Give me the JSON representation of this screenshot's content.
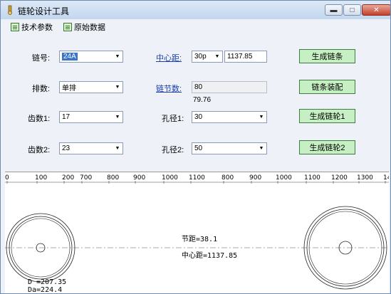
{
  "window": {
    "title": "链轮设计工具",
    "minimize_glyph": "▬",
    "maximize_glyph": "□",
    "close_glyph": "✕"
  },
  "toolbar": {
    "tech_params": "技术参数",
    "raw_data": "原始数据"
  },
  "form": {
    "chain_no_label": "链号:",
    "chain_no_value": "24A",
    "rows_label": "排数:",
    "rows_value": "单排",
    "teeth1_label": "齿数1:",
    "teeth1_value": "17",
    "teeth2_label": "齿数2:",
    "teeth2_value": "23",
    "center_label": "中心距:",
    "center_unit_value": "30p",
    "center_value": "1137.85",
    "links_label": "链节数:",
    "links_value": "80",
    "links_calc": "79.76",
    "bore1_label": "孔径1:",
    "bore1_value": "30",
    "bore2_label": "孔径2:",
    "bore2_value": "50"
  },
  "buttons": {
    "gen_chain": "生成链条",
    "chain_assembly": "链条装配",
    "gen_sprocket1": "生成链轮1",
    "gen_sprocket2": "生成链轮2"
  },
  "ruler": {
    "ticks": [
      "0",
      "100",
      "200",
      "700",
      "800",
      "900",
      "1000",
      "1100",
      "800",
      "900",
      "1000",
      "1100",
      "1200",
      "1300",
      "140"
    ]
  },
  "drawing": {
    "pitch_text": "节距=38.1",
    "center_text": "中心距=1137.85",
    "d_text": "D =207.35",
    "da_text": "Da=224.4"
  },
  "colors": {
    "button_green": "#c6f0c3",
    "link_blue": "#1b3fa6",
    "selection_blue": "#3a74c9"
  }
}
